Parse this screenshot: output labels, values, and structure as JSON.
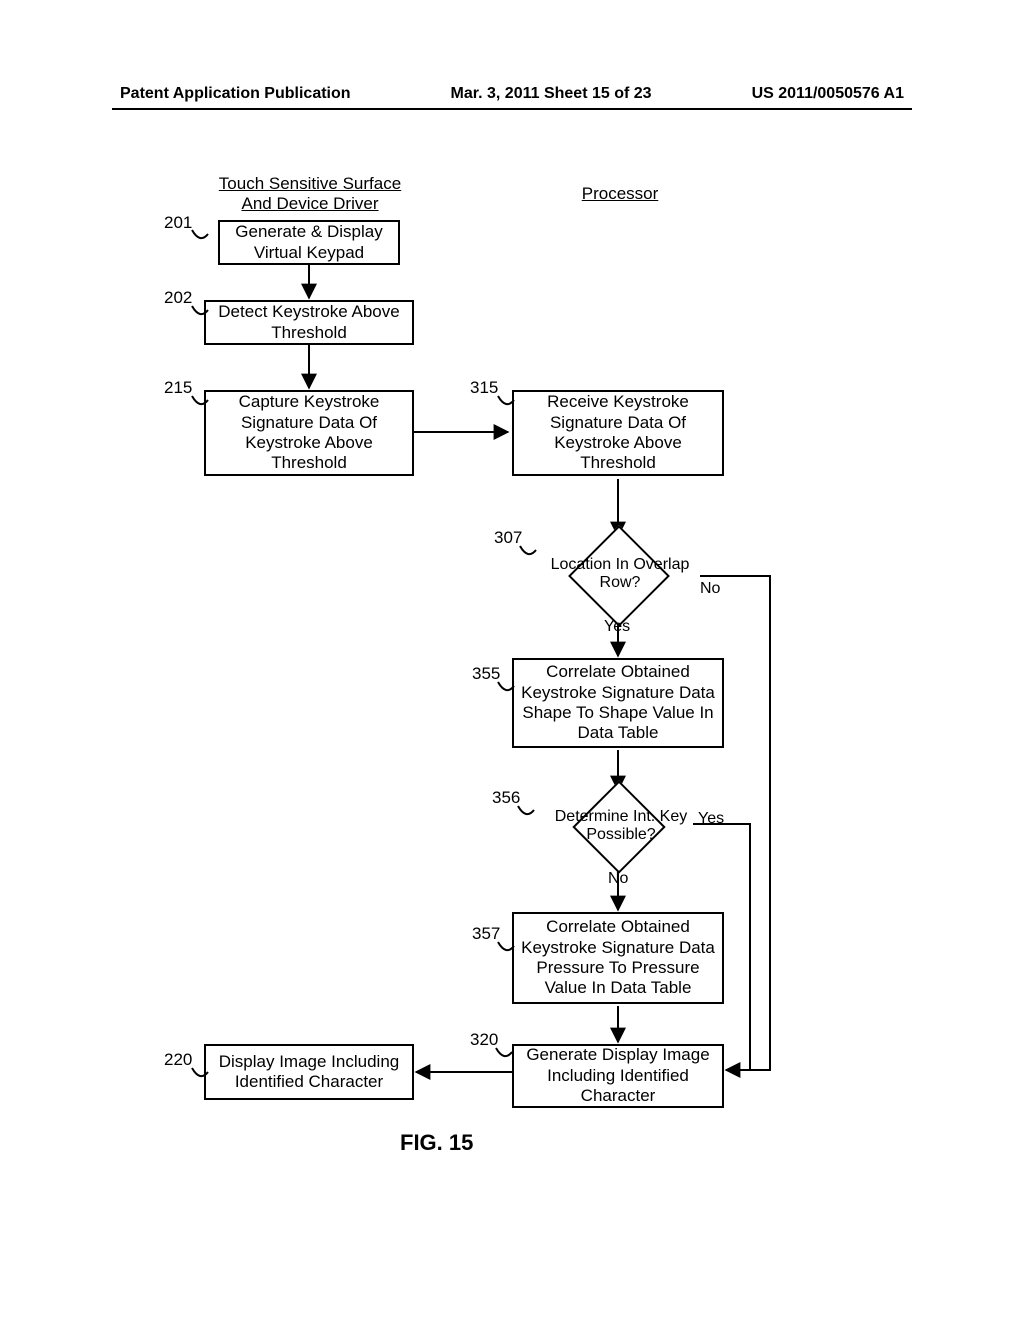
{
  "header": {
    "left": "Patent Application Publication",
    "mid": "Mar. 3, 2011  Sheet 15 of 23",
    "right": "US 2011/0050576 A1"
  },
  "columns": {
    "left": "Touch Sensitive Surface And Device Driver",
    "right": "Processor"
  },
  "boxes": {
    "b201": "Generate & Display Virtual Keypad",
    "b202": "Detect Keystroke Above Threshold",
    "b215": "Capture Keystroke Signature Data Of Keystroke Above Threshold",
    "b315": "Receive Keystroke Signature Data Of Keystroke Above Threshold",
    "b355": "Correlate Obtained Keystroke Signature Data Shape To Shape Value In Data Table",
    "b357": "Correlate Obtained Keystroke Signature Data Pressure To Pressure Value In Data Table",
    "b320": "Generate Display Image Including Identified Character",
    "b220": "Display Image Including Identified Character"
  },
  "diamonds": {
    "d307": "Location In Overlap Row?",
    "d356": "Determine Int. Key Possible?"
  },
  "branch": {
    "yes": "Yes",
    "no": "No"
  },
  "refs": {
    "r201": "201",
    "r202": "202",
    "r215": "215",
    "r315": "315",
    "r307": "307",
    "r355": "355",
    "r356": "356",
    "r357": "357",
    "r320": "320",
    "r220": "220"
  },
  "figure": "FIG. 15"
}
